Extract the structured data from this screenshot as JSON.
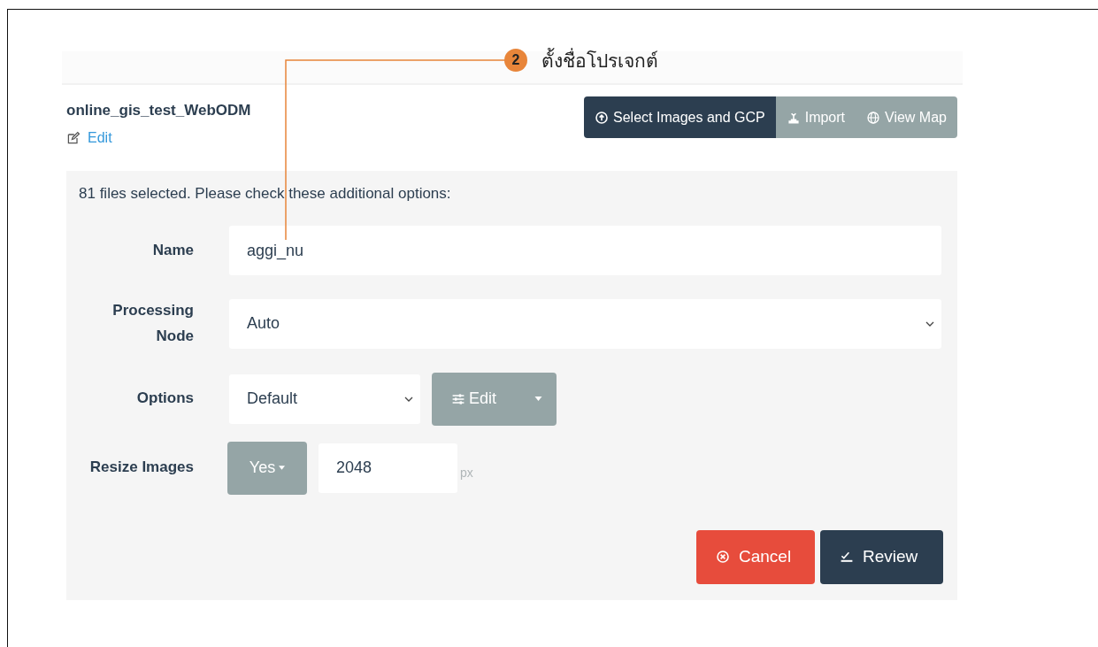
{
  "annotation": {
    "number": "2",
    "text": "ตั้งชื่อโปรเจกต์"
  },
  "project": {
    "title": "online_gis_test_WebODM",
    "edit_link": "Edit"
  },
  "toolbar": [
    {
      "kind": "upload",
      "label": "Select Images and GCP",
      "selected": true
    },
    {
      "kind": "import",
      "label": "Import",
      "selected": false
    },
    {
      "kind": "map",
      "label": "View Map",
      "selected": false
    }
  ],
  "form": {
    "message": "81 files selected. Please check these additional options:",
    "fields": [
      {
        "kind": "text",
        "label": "Name",
        "value": "aggi_nu"
      },
      {
        "kind": "select",
        "label": "Processing Node",
        "value": "Auto"
      },
      {
        "kind": "options",
        "label": "Options",
        "value": "Default",
        "button": "Edit"
      },
      {
        "kind": "resize",
        "label": "Resize Images",
        "toggle": "Yes",
        "value": "2048",
        "unit": "px"
      }
    ]
  },
  "actions": [
    {
      "kind": "cancel",
      "label": "Cancel"
    },
    {
      "kind": "review",
      "label": "Review"
    }
  ]
}
